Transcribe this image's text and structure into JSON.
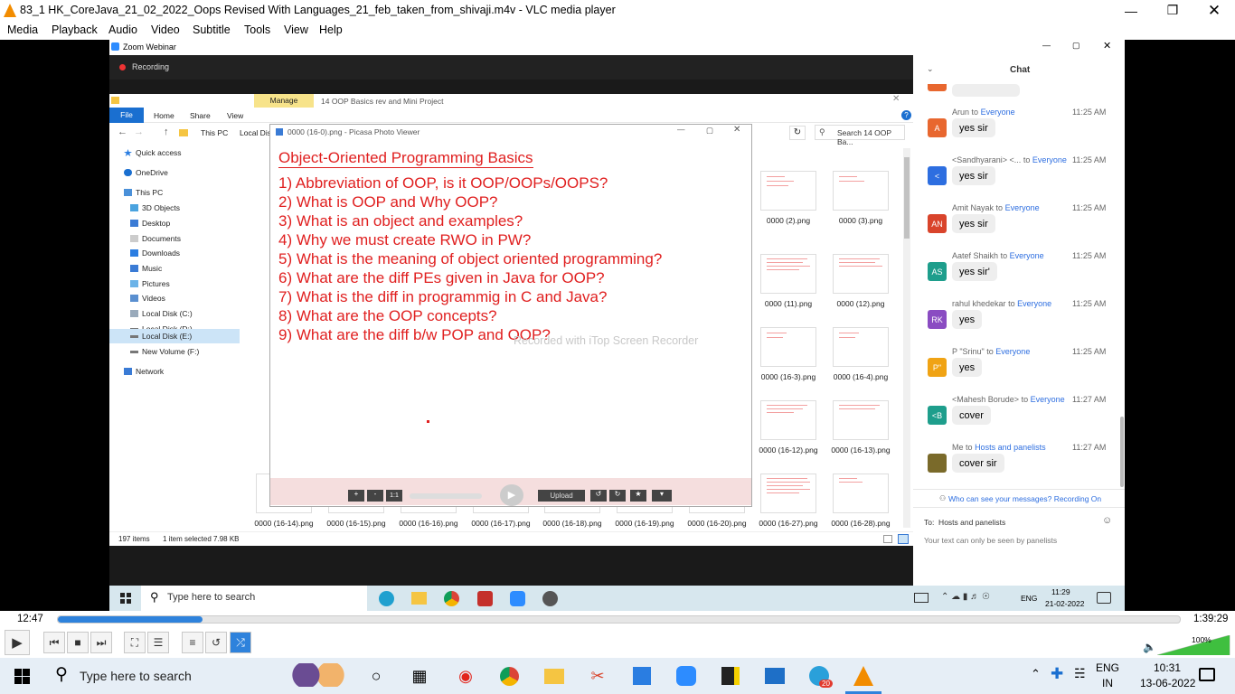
{
  "vlc": {
    "title": "83_1 HK_CoreJava_21_02_2022_Oops Revised With Languages_21_feb_taken_from_shivaji.m4v - VLC media player",
    "menu": [
      "Media",
      "Playback",
      "Audio",
      "Video",
      "Subtitle",
      "Tools",
      "View",
      "Help"
    ],
    "time_elapsed": "12:47",
    "time_total": "1:39:29",
    "progress": 0.129,
    "volume_label": "100%",
    "volume": 1.0
  },
  "zoom": {
    "title": "Zoom Webinar",
    "recording_label": "Recording"
  },
  "explorer": {
    "ribbon_tabs": [
      "File",
      "Home",
      "Share",
      "View"
    ],
    "manage_tab": "Manage",
    "window_title": "14 OOP Basics rev and Mini Project",
    "address": [
      "This PC",
      "Local Dis"
    ],
    "search_placeholder": "Search 14 OOP Ba...",
    "nav": [
      "Quick access",
      "OneDrive",
      "This PC",
      "3D Objects",
      "Desktop",
      "Documents",
      "Downloads",
      "Music",
      "Pictures",
      "Videos",
      "Local Disk (C:)",
      "Local Disk (D:)",
      "Local Disk (E:)",
      "New Volume (F:)",
      "Network"
    ],
    "right_files": [
      "0000 (2).png",
      "0000 (3).png",
      "0000 (11).png",
      "0000 (12).png",
      "0000 (16-3).png",
      "0000 (16-4).png",
      "0000 (16-12).png",
      "0000 (16-13).png"
    ],
    "bottom_files": [
      "0000 (16-14).png",
      "0000 (16-15).png",
      "0000 (16-16).png",
      "0000 (16-17).png",
      "0000 (16-18).png",
      "0000 (16-19).png",
      "0000 (16-20).png",
      "0000 (16-27).png",
      "0000 (16-28).png"
    ],
    "status_items": "197 items",
    "status_selected": "1 item selected  7.98 KB"
  },
  "picasa": {
    "title": "0000 (16-0).png - Picasa Photo Viewer",
    "heading": "Object-Oriented Programming Basics",
    "questions": [
      "1) Abbreviation of OOP, is it OOP/OOPs/OOPS?",
      "2) What is OOP and Why OOP?",
      "3) What is an object and examples?",
      "4) Why we must create RWO in PW?",
      "5) What is the meaning of object oriented programming?",
      "6) What are the diff PEs given in Java for OOP?",
      "7) What is the diff in programmig in C and Java?",
      "8) What are the OOP concepts?",
      "9) What are the diff b/w POP and OOP?"
    ],
    "watermark": "Recorded with iTop Screen Recorder",
    "upload_label": "Upload",
    "zoom_label": "1:1"
  },
  "chat": {
    "title": "Chat",
    "to_word": "to",
    "messages": [
      {
        "sender": "Arun",
        "to": "Everyone",
        "time": "11:25 AM",
        "text": "yes sir",
        "initials": "A",
        "color": "#e8672f"
      },
      {
        "sender": "<Sandhyarani> <...",
        "to": "Everyone",
        "time": "11:25 AM",
        "text": "yes sir",
        "initials": "<",
        "color": "#2d6ee0"
      },
      {
        "sender": "Amit Nayak",
        "to": "Everyone",
        "time": "11:25 AM",
        "text": "yes sir",
        "initials": "AN",
        "color": "#d9442b"
      },
      {
        "sender": "Aatef Shaikh",
        "to": "Everyone",
        "time": "11:25 AM",
        "text": "yes sir'",
        "initials": "AS",
        "color": "#1e9e8c"
      },
      {
        "sender": "rahul khedekar",
        "to": "Everyone",
        "time": "11:25 AM",
        "text": "yes",
        "initials": "RK",
        "color": "#8a4cc2"
      },
      {
        "sender": "P \"Srinu\"",
        "to": "Everyone",
        "time": "11:25 AM",
        "text": "yes",
        "initials": "P\"",
        "color": "#f0a314"
      },
      {
        "sender": "<Mahesh Borude>",
        "to": "Everyone",
        "time": "11:27 AM",
        "text": "cover",
        "initials": "<B",
        "color": "#1e9e8c"
      },
      {
        "sender": "Me",
        "to": "Hosts and panelists",
        "time": "11:27 AM",
        "text": "cover sir",
        "initials": "",
        "color": "#7a6a2a"
      }
    ],
    "visibility_note": "Who can see your messages? Recording On",
    "to_field": "To:  Hosts and panelists",
    "input_hint": "Your text can only be seen by panelists"
  },
  "inner_taskbar": {
    "search": "Type here to search",
    "lang": "ENG",
    "time": "11:29",
    "date": "21-02-2022"
  },
  "taskbar": {
    "search": "Type here to search",
    "lang": "ENG",
    "region": "IN",
    "time": "10:31",
    "date": "13-06-2022",
    "telegram_badge": "20"
  }
}
